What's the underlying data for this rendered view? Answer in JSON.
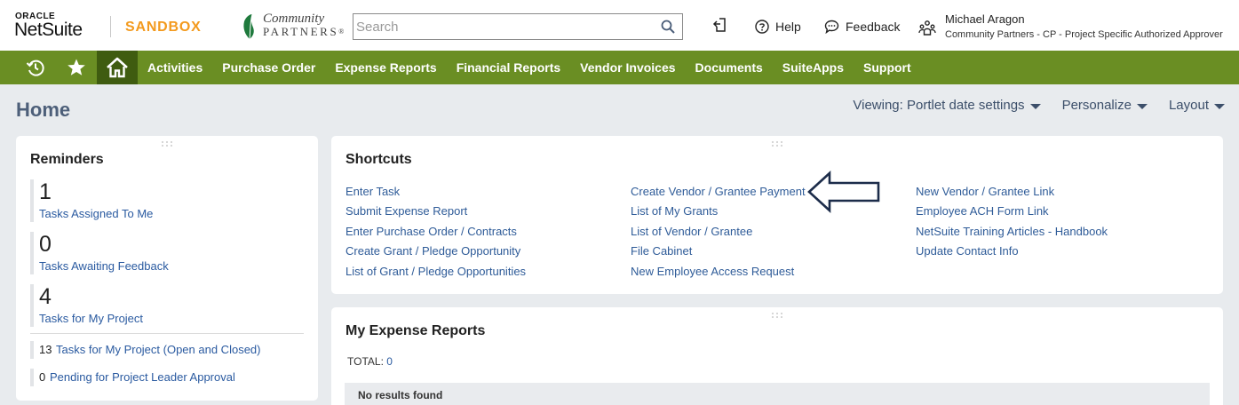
{
  "header": {
    "oracle_label": "ORACLE",
    "product_label": "NetSuite",
    "environment_label": "SANDBOX",
    "company_logo": {
      "line1": "Community",
      "line2": "PARTNERS",
      "mark": "®"
    },
    "search": {
      "placeholder": "Search",
      "value": ""
    },
    "help_label": "Help",
    "feedback_label": "Feedback",
    "user": {
      "name": "Michael Aragon",
      "role": "Community Partners - CP - Project Specific Authorized Approver"
    }
  },
  "nav": {
    "items": [
      "Activities",
      "Purchase Order",
      "Expense Reports",
      "Financial Reports",
      "Vendor Invoices",
      "Documents",
      "SuiteApps",
      "Support"
    ]
  },
  "page": {
    "title": "Home",
    "controls": {
      "viewing": "Viewing: Portlet date settings",
      "personalize": "Personalize",
      "layout": "Layout"
    }
  },
  "reminders": {
    "title": "Reminders",
    "big_items": [
      {
        "count": "1",
        "label": "Tasks Assigned To Me"
      },
      {
        "count": "0",
        "label": "Tasks Awaiting Feedback"
      },
      {
        "count": "4",
        "label": "Tasks for My Project"
      }
    ],
    "small_items": [
      {
        "count": "13",
        "label": "Tasks for My Project (Open and Closed)"
      },
      {
        "count": "0",
        "label": "Pending for Project Leader Approval"
      }
    ]
  },
  "shortcuts": {
    "title": "Shortcuts",
    "columns": [
      [
        "Enter Task",
        "Submit Expense Report",
        "Enter Purchase Order / Contracts",
        "Create Grant / Pledge Opportunity",
        "List of Grant / Pledge Opportunities"
      ],
      [
        "Create Vendor / Grantee Payment",
        "List of My Grants",
        "List of Vendor / Grantee",
        "File Cabinet",
        "New Employee Access Request"
      ],
      [
        "New Vendor / Grantee Link",
        "Employee ACH Form Link",
        "NetSuite Training Articles - Handbook",
        "Update Contact Info"
      ]
    ]
  },
  "expense_reports": {
    "title": "My Expense Reports",
    "total_label": "TOTAL:",
    "total_value": "0",
    "empty_message": "No results found"
  },
  "colors": {
    "nav_bg": "#6a8e23",
    "nav_active": "#3f5c10",
    "sandbox": "#f39a1e",
    "link": "#2e5b98",
    "title": "#4d5f79"
  },
  "icons": [
    "recent-records-icon",
    "favorites-star-icon",
    "home-icon",
    "search-icon",
    "recent-page-icon",
    "help-icon",
    "feedback-icon",
    "role-switch-icon",
    "drag-grip-icon",
    "annotation-arrow-icon"
  ]
}
